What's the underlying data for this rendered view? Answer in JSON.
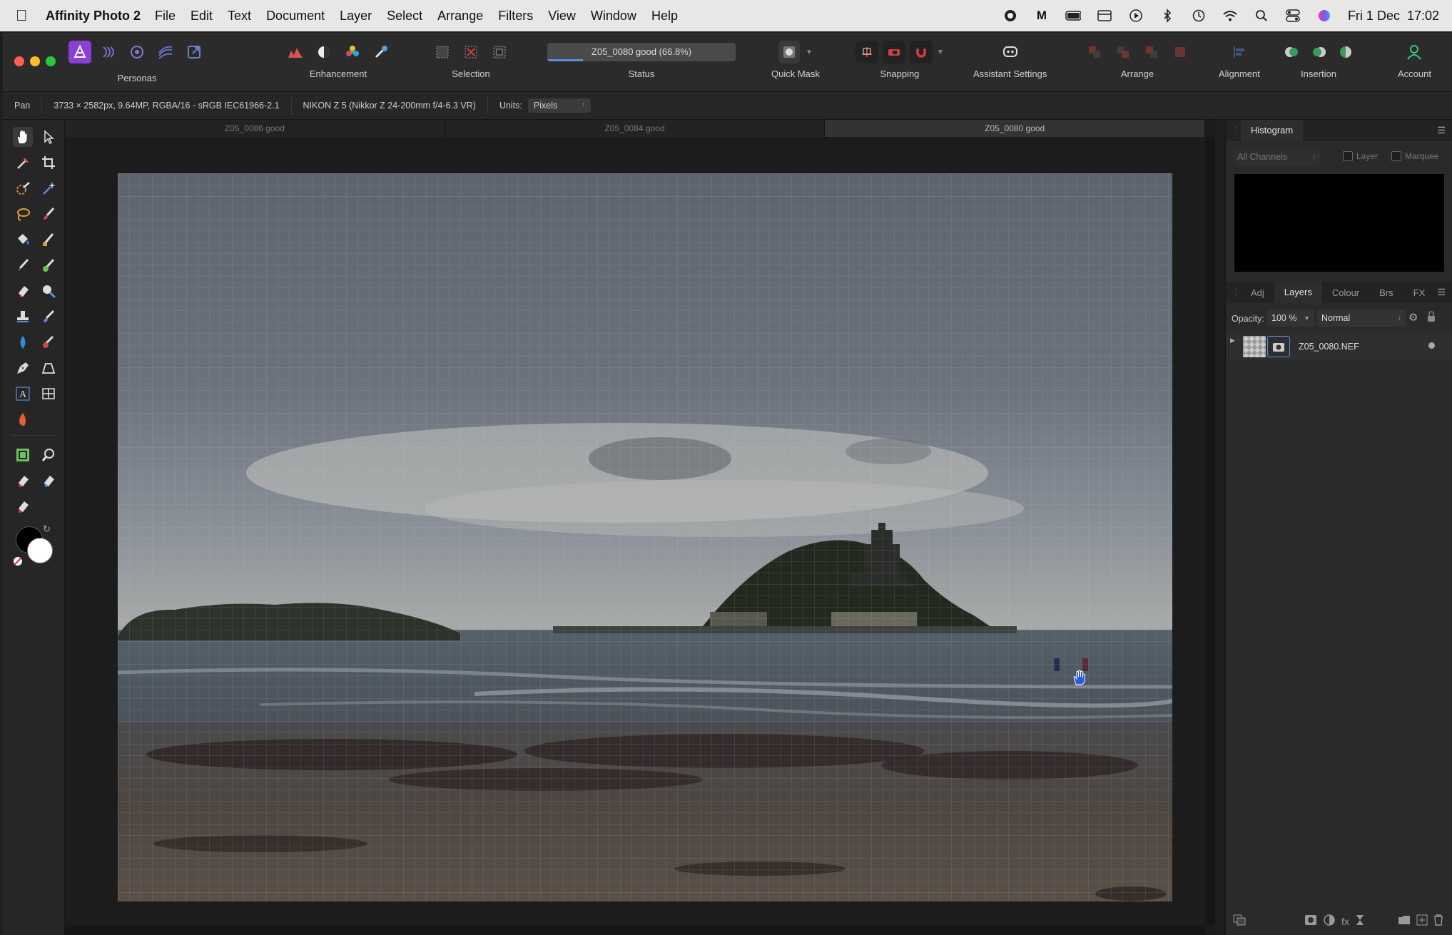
{
  "menubar": {
    "app_name": "Affinity Photo 2",
    "items": [
      "File",
      "Edit",
      "Text",
      "Document",
      "Layer",
      "Select",
      "Arrange",
      "Filters",
      "View",
      "Window",
      "Help"
    ],
    "clock": "Fri 1 Dec  17:02",
    "status_icons": [
      "record-icon",
      "m-icon",
      "battery-icon",
      "calendar-icon",
      "play-icon",
      "bluetooth-icon",
      "time-machine-icon",
      "wifi-icon",
      "spotlight-icon",
      "control-center-icon",
      "siri-icon"
    ]
  },
  "toolbar": {
    "personas_label": "Personas",
    "enhancement_label": "Enhancement",
    "selection_label": "Selection",
    "status_label": "Status",
    "status_value": "Z05_0080 good (66.8%)",
    "quick_mask_label": "Quick Mask",
    "snapping_label": "Snapping",
    "assistant_label": "Assistant Settings",
    "arrange_label": "Arrange",
    "alignment_label": "Alignment",
    "insertion_label": "Insertion",
    "account_label": "Account"
  },
  "contextbar": {
    "tool": "Pan",
    "doc_info": "3733 × 2582px, 9.64MP, RGBA/16 - sRGB IEC61966-2.1",
    "camera": "NIKON Z 5 (Nikkor Z 24-200mm f/4-6.3 VR)",
    "units_label": "Units:",
    "units_value": "Pixels"
  },
  "doc_tabs": [
    "Z05_0086 good",
    "Z05_0084 good",
    "Z05_0080 good"
  ],
  "active_tab_index": 2,
  "histogram": {
    "title": "Histogram",
    "channels": "All Channels",
    "layer_label": "Layer",
    "marquee_label": "Marquee"
  },
  "layers_panel": {
    "tabs": [
      "Adj",
      "Layers",
      "Colour",
      "Brs",
      "FX"
    ],
    "active_tab": "Layers",
    "opacity_label": "Opacity:",
    "opacity_value": "100 %",
    "blend_mode": "Normal",
    "layers": [
      {
        "name": "Z05_0080.NEF"
      }
    ]
  },
  "colors": {
    "accent": "#5a8de0",
    "persona_purple": "#8a3fd8",
    "traffic_red": "#fe5f57",
    "traffic_yellow": "#febc2e",
    "traffic_green": "#28c840"
  }
}
